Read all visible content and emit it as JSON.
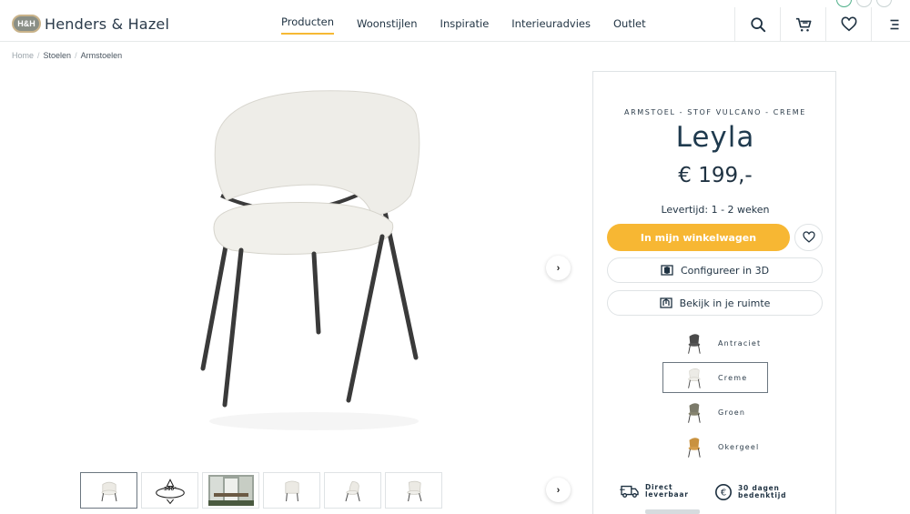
{
  "brand": {
    "name": "Henders & Hazel",
    "badge": "H&H"
  },
  "nav": {
    "items": [
      {
        "label": "Producten",
        "active": true
      },
      {
        "label": "Woonstijlen",
        "active": false
      },
      {
        "label": "Inspiratie",
        "active": false
      },
      {
        "label": "Interieuradvies",
        "active": false
      },
      {
        "label": "Outlet",
        "active": false
      }
    ]
  },
  "header_icons": [
    "search-icon",
    "cart-icon",
    "heart-icon",
    "menu-icon"
  ],
  "breadcrumb": {
    "home": "Home",
    "level1": "Stoelen",
    "level2": "Armstoelen"
  },
  "product": {
    "subtitle": "ARMSTOEL - STOF VULCANO - CREME",
    "name": "Leyla",
    "price": "€ 199,-",
    "delivery": "Levertijd: 1 - 2 weken",
    "cart_label": "In mijn winkelwagen",
    "configure_label": "Configureer in 3D",
    "room_label": "Bekijk in je ruimte"
  },
  "swatches": [
    {
      "label": "Antraciet",
      "color": "#4a4a4a",
      "selected": false
    },
    {
      "label": "Creme",
      "color": "#ecebe6",
      "selected": true
    },
    {
      "label": "Groen",
      "color": "#7b7a6a",
      "selected": false
    },
    {
      "label": "Okergeel",
      "color": "#c9923f",
      "selected": false
    }
  ],
  "usps": [
    {
      "line1": "Direct",
      "line2": "leverbaar"
    },
    {
      "line1": "30 dagen",
      "line2": "bedenktijd"
    }
  ],
  "thumbs": [
    "chair-front",
    "360-view",
    "room-photo",
    "chair-back",
    "chair-side",
    "chair-angle"
  ],
  "thumb_360_label": "360°",
  "colors": {
    "accent": "#f7b733",
    "text": "#1f3242",
    "border": "#dfe3e5"
  }
}
